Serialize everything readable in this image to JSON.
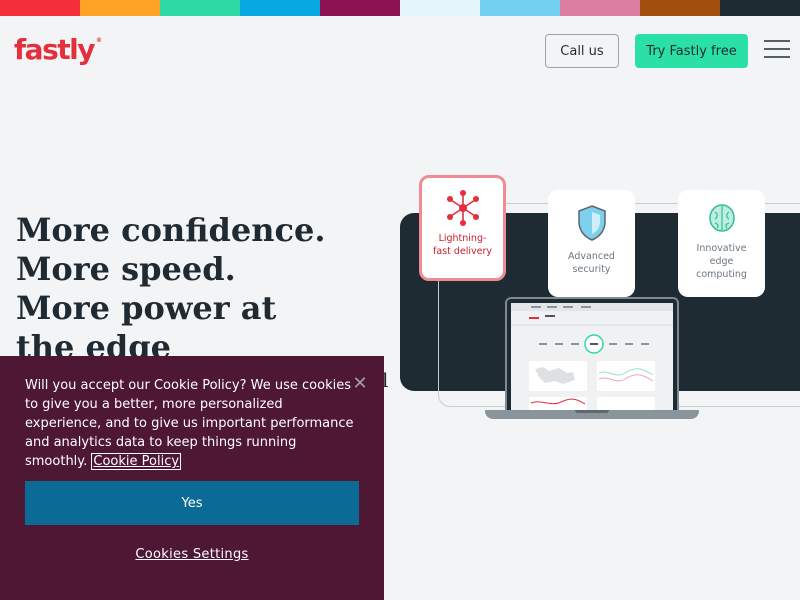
{
  "colors": {
    "stripe": [
      "#f3303b",
      "#ffa326",
      "#2fd9a5",
      "#07a9e0",
      "#8b1253",
      "#e4f6fb",
      "#72d1ef",
      "#dc7ea0",
      "#a24f0f",
      "#1f2b33"
    ],
    "brand": "#e42f3c",
    "accent": "#2ae0a5",
    "cookie_bg": "#4e1734",
    "cookie_button": "#0c6b96"
  },
  "header": {
    "logo_text": "fastly",
    "logo_mark": "®",
    "call_label": "Call us",
    "try_label": "Try Fastly free",
    "menu_icon": "hamburger-menu-icon"
  },
  "hero": {
    "title_lines": [
      "More confidence.",
      "More speed.",
      "More power at",
      "the edge"
    ],
    "partial_text": "l"
  },
  "cards": [
    {
      "label": "Lightning-fast delivery",
      "icon": "network-icon"
    },
    {
      "label": "Advanced security",
      "icon": "shield-icon"
    },
    {
      "label": "Innovative edge computing",
      "icon": "brain-icon"
    }
  ],
  "cookie": {
    "text": "Will you accept our Cookie Policy? We use cookies to give you a better, more personalized experience, and to give us important performance and analytics data to keep things running smoothly.",
    "link": "Cookie Policy",
    "close_icon": "close-icon",
    "yes_label": "Yes",
    "settings_label": "Cookies Settings"
  }
}
